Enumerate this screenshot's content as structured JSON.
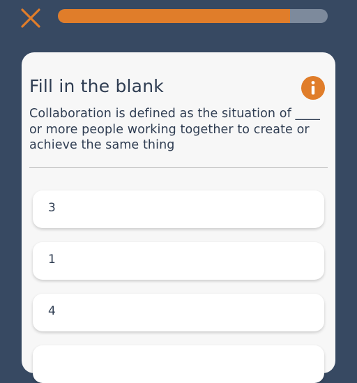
{
  "progress": {
    "fraction": 0.86
  },
  "colors": {
    "accent": "#e07d2a",
    "background": "#374962",
    "card": "#f7f7f7",
    "text": "#2f3d52"
  },
  "icons": {
    "close": "close-icon",
    "info": "info-icon"
  },
  "card": {
    "title": "Fill in the blank",
    "question": "Collaboration is defined as the situation of ____ or more people working together to create or achieve the same thing"
  },
  "options": [
    {
      "label": "3"
    },
    {
      "label": "1"
    },
    {
      "label": "4"
    },
    {
      "label": ""
    }
  ]
}
